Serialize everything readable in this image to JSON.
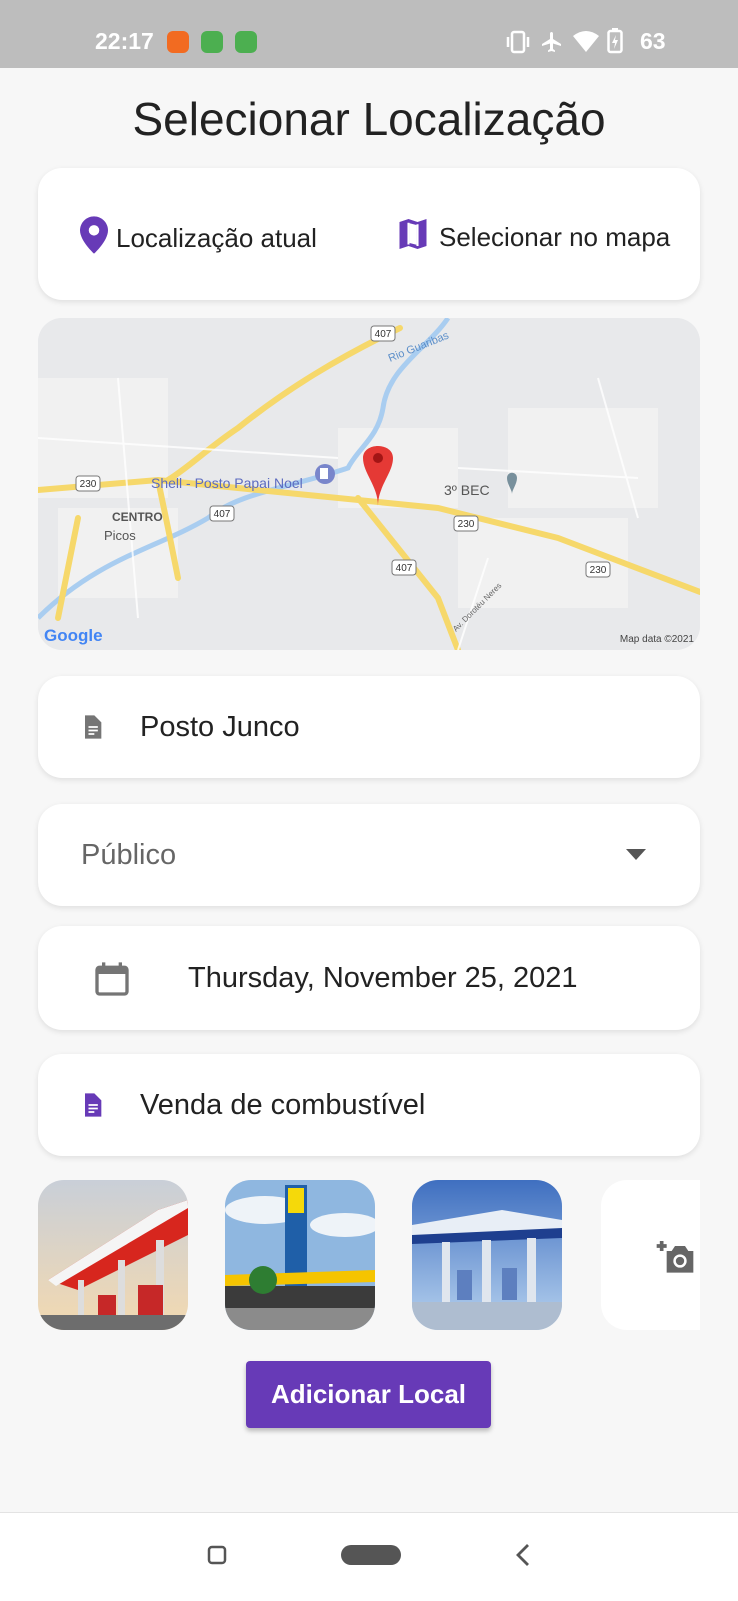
{
  "status_bar": {
    "time": "22:17",
    "battery": "63",
    "icons": [
      "vibrate-icon",
      "airplane-icon",
      "wifi-icon",
      "battery-icon"
    ]
  },
  "page": {
    "title": "Selecionar Localização"
  },
  "location_options": {
    "current_label": "Localização atual",
    "map_label": "Selecionar no mapa"
  },
  "map": {
    "labels": {
      "shell": "Shell - Posto Papai Noel",
      "bec": "3º BEC",
      "centro": "CENTRO",
      "picos": "Picos",
      "rio": "Rio Guaribas",
      "avenida": "Av. Dorotéu Neres",
      "google": "Google",
      "attribution": "Map data ©2021"
    },
    "shields": [
      "407",
      "230",
      "407",
      "230",
      "407",
      "230"
    ]
  },
  "form": {
    "name_value": "Posto Junco",
    "visibility_value": "Público",
    "date_value": "Thursday, November 25, 2021",
    "description_value": "Venda de combustível"
  },
  "photos": [
    "gas-station-photo-1",
    "gas-station-photo-2",
    "gas-station-photo-3"
  ],
  "actions": {
    "add_button": "Adicionar Local"
  },
  "colors": {
    "accent": "#673ab7",
    "pin": "#e53935",
    "background": "#f7f7f7"
  }
}
